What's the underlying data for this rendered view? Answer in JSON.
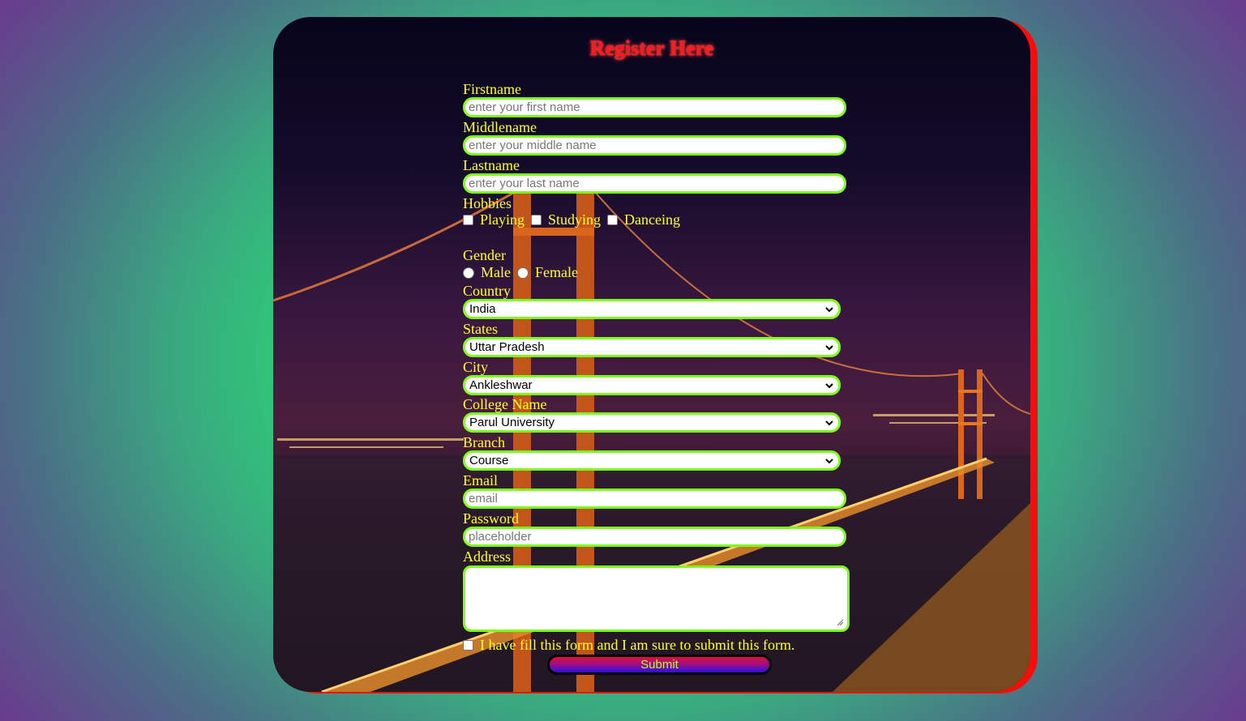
{
  "form": {
    "title": "Register Here",
    "firstname": {
      "label": "Firstname",
      "placeholder": "enter your first name",
      "value": ""
    },
    "middlename": {
      "label": "Middlename",
      "placeholder": "enter your middle name",
      "value": ""
    },
    "lastname": {
      "label": "Lastname",
      "placeholder": "enter your last name",
      "value": ""
    },
    "hobbies": {
      "label": "Hobbies",
      "options": [
        {
          "label": "Playing",
          "checked": false
        },
        {
          "label": "Studying",
          "checked": false
        },
        {
          "label": "Danceing",
          "checked": false
        }
      ]
    },
    "gender": {
      "label": "Gender",
      "options": [
        {
          "label": "Male",
          "selected": false
        },
        {
          "label": "Female",
          "selected": false
        }
      ]
    },
    "country": {
      "label": "Country",
      "value": "India"
    },
    "states": {
      "label": "States",
      "value": "Uttar Pradesh"
    },
    "city": {
      "label": "City",
      "value": "Ankleshwar"
    },
    "college": {
      "label": "College Name",
      "value": "Parul University"
    },
    "branch": {
      "label": "Branch",
      "value": "Course"
    },
    "email": {
      "label": "Email",
      "placeholder": "email",
      "value": ""
    },
    "password": {
      "label": "Password",
      "placeholder": "placeholder",
      "value": ""
    },
    "address": {
      "label": "Address",
      "value": ""
    },
    "agree": {
      "label": "I have fill this form and I am sure to submit this form.",
      "checked": false
    },
    "submit_label": "Submit"
  },
  "colors": {
    "label": "#ffff2a",
    "title": "#ff1a1a",
    "field_border": "#7cff1a",
    "card_shadow": "#ff0a0a",
    "submit_text": "#b5ff3a"
  }
}
